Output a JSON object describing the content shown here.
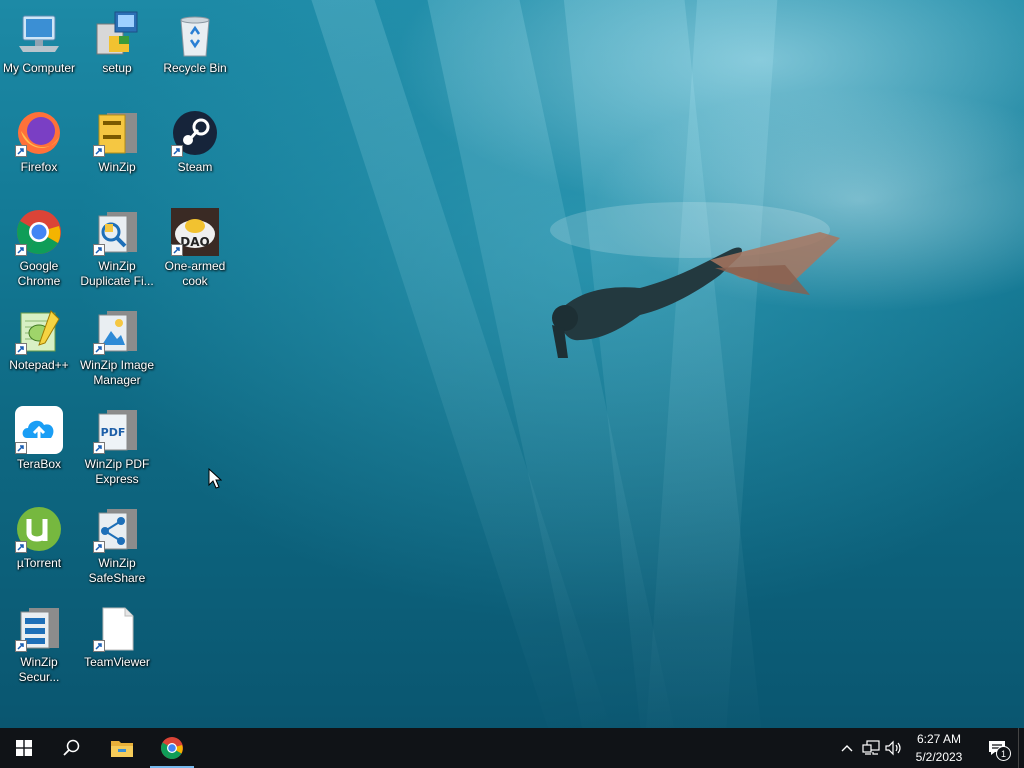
{
  "desktop": {
    "icons": [
      {
        "label": "My Computer",
        "icon": "computer-icon",
        "shortcut": false
      },
      {
        "label": "setup",
        "icon": "setup-installer-icon",
        "shortcut": false
      },
      {
        "label": "Recycle Bin",
        "icon": "recycle-bin-icon",
        "shortcut": false
      },
      {
        "label": "Firefox",
        "icon": "firefox-icon",
        "shortcut": true
      },
      {
        "label": "WinZip",
        "icon": "winzip-icon",
        "shortcut": true
      },
      {
        "label": "Steam",
        "icon": "steam-icon",
        "shortcut": true
      },
      {
        "label": "Google\nChrome",
        "icon": "chrome-icon",
        "shortcut": true
      },
      {
        "label": "WinZip\nDuplicate Fi...",
        "icon": "winzip-duplicate-finder-icon",
        "shortcut": true
      },
      {
        "label": "One-armed\ncook",
        "icon": "one-armed-cook-game-icon",
        "shortcut": true
      },
      {
        "label": "Notepad++",
        "icon": "notepadplusplus-icon",
        "shortcut": true
      },
      {
        "label": "WinZip Image\nManager",
        "icon": "winzip-image-manager-icon",
        "shortcut": true
      },
      {
        "label": "TeraBox",
        "icon": "terabox-icon",
        "shortcut": true
      },
      {
        "label": "WinZip PDF\nExpress",
        "icon": "winzip-pdf-express-icon",
        "shortcut": true
      },
      {
        "label": "µTorrent",
        "icon": "utorrent-icon",
        "shortcut": true
      },
      {
        "label": "WinZip\nSafeShare",
        "icon": "winzip-safeshare-icon",
        "shortcut": true
      },
      {
        "label": "WinZip\nSecur...",
        "icon": "winzip-secure-backup-icon",
        "shortcut": true
      },
      {
        "label": "TeamViewer",
        "icon": "teamviewer-blank-file-icon",
        "shortcut": true
      }
    ]
  },
  "taskbar": {
    "start_icon": "windows-start-icon",
    "search_icon": "search-icon",
    "pinned": [
      {
        "name": "file-explorer",
        "icon": "folder-icon",
        "active": false
      },
      {
        "name": "chrome",
        "icon": "chrome-icon",
        "active": true
      }
    ],
    "tray": {
      "chevron_icon": "chevron-up-icon",
      "network_icon": "network-icon",
      "volume_icon": "volume-icon"
    },
    "clock": {
      "time": "6:27 AM",
      "date": "5/2/2023"
    },
    "notifications": {
      "icon": "action-center-icon",
      "count": "1"
    }
  }
}
